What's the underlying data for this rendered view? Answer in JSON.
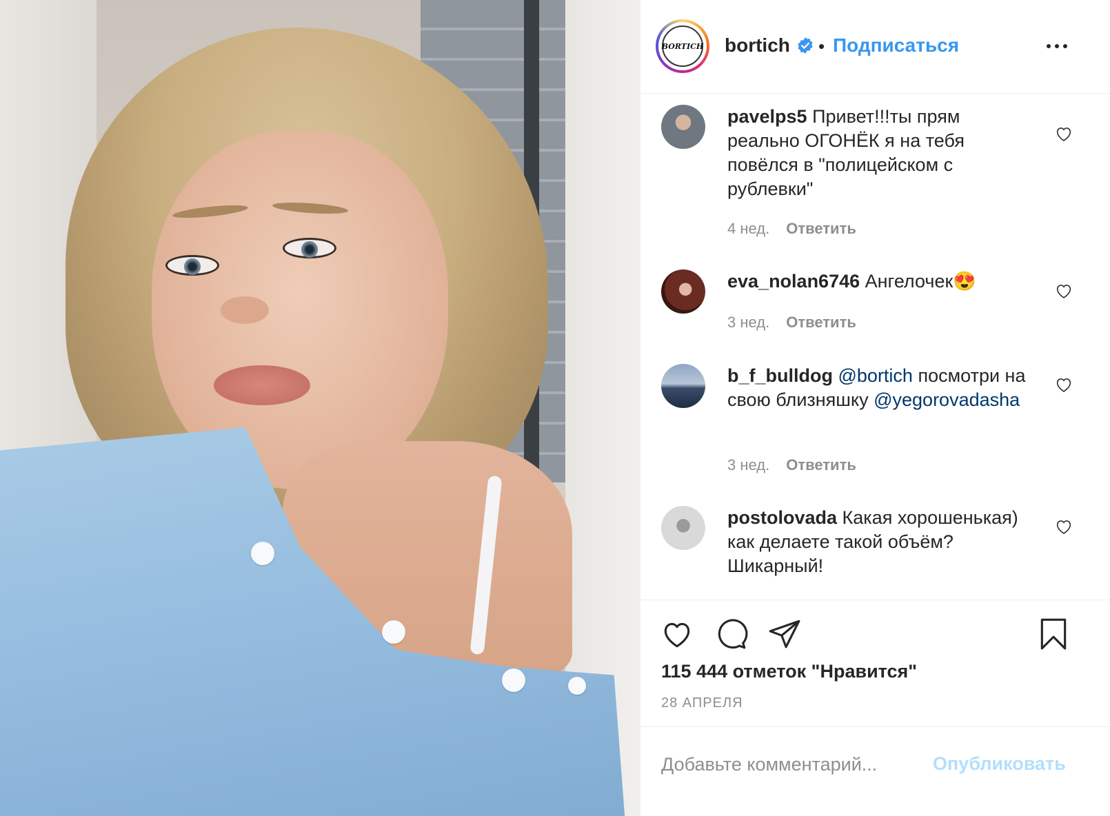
{
  "post": {
    "username": "bortich",
    "follow_label": "Подписаться",
    "separator": "•",
    "avatar_logo_text": "BORTICH",
    "likes_text": "115 444 отметок \"Нравится\"",
    "date": "28 АПРЕЛЯ"
  },
  "comments": [
    {
      "user": "pavelps5",
      "text": "Привет!!!ты прям реально ОГОНЁК я на тебя повёлся в \"полицейском с рублевки\"",
      "age": "4 нед.",
      "reply": "Ответить"
    },
    {
      "user": "eva_nolan6746",
      "text": "Ангелочек😍",
      "age": "3 нед.",
      "reply": "Ответить"
    },
    {
      "user": "b_f_bulldog",
      "mention1": "@bortich",
      "text": "посмотри на свою близняшку",
      "mention2": "@yegorovadasha",
      "age": "3 нед.",
      "reply": "Ответить"
    },
    {
      "user": "postolovada",
      "text": "Какая хорошенькая) как делаете такой объём? Шикарный!"
    }
  ],
  "add_comment": {
    "placeholder": "Добавьте комментарий...",
    "publish_label": "Опубликовать"
  },
  "icons": {
    "verified": "verified-badge-icon",
    "more": "more-options-icon",
    "like": "heart-icon",
    "comment": "comment-bubble-icon",
    "share": "paper-plane-icon",
    "save": "bookmark-icon"
  },
  "colors": {
    "link_blue": "#3897f0",
    "publish_disabled": "#b2dffc",
    "mention": "#00376b",
    "muted": "#8e8e8e",
    "text": "#262626"
  }
}
